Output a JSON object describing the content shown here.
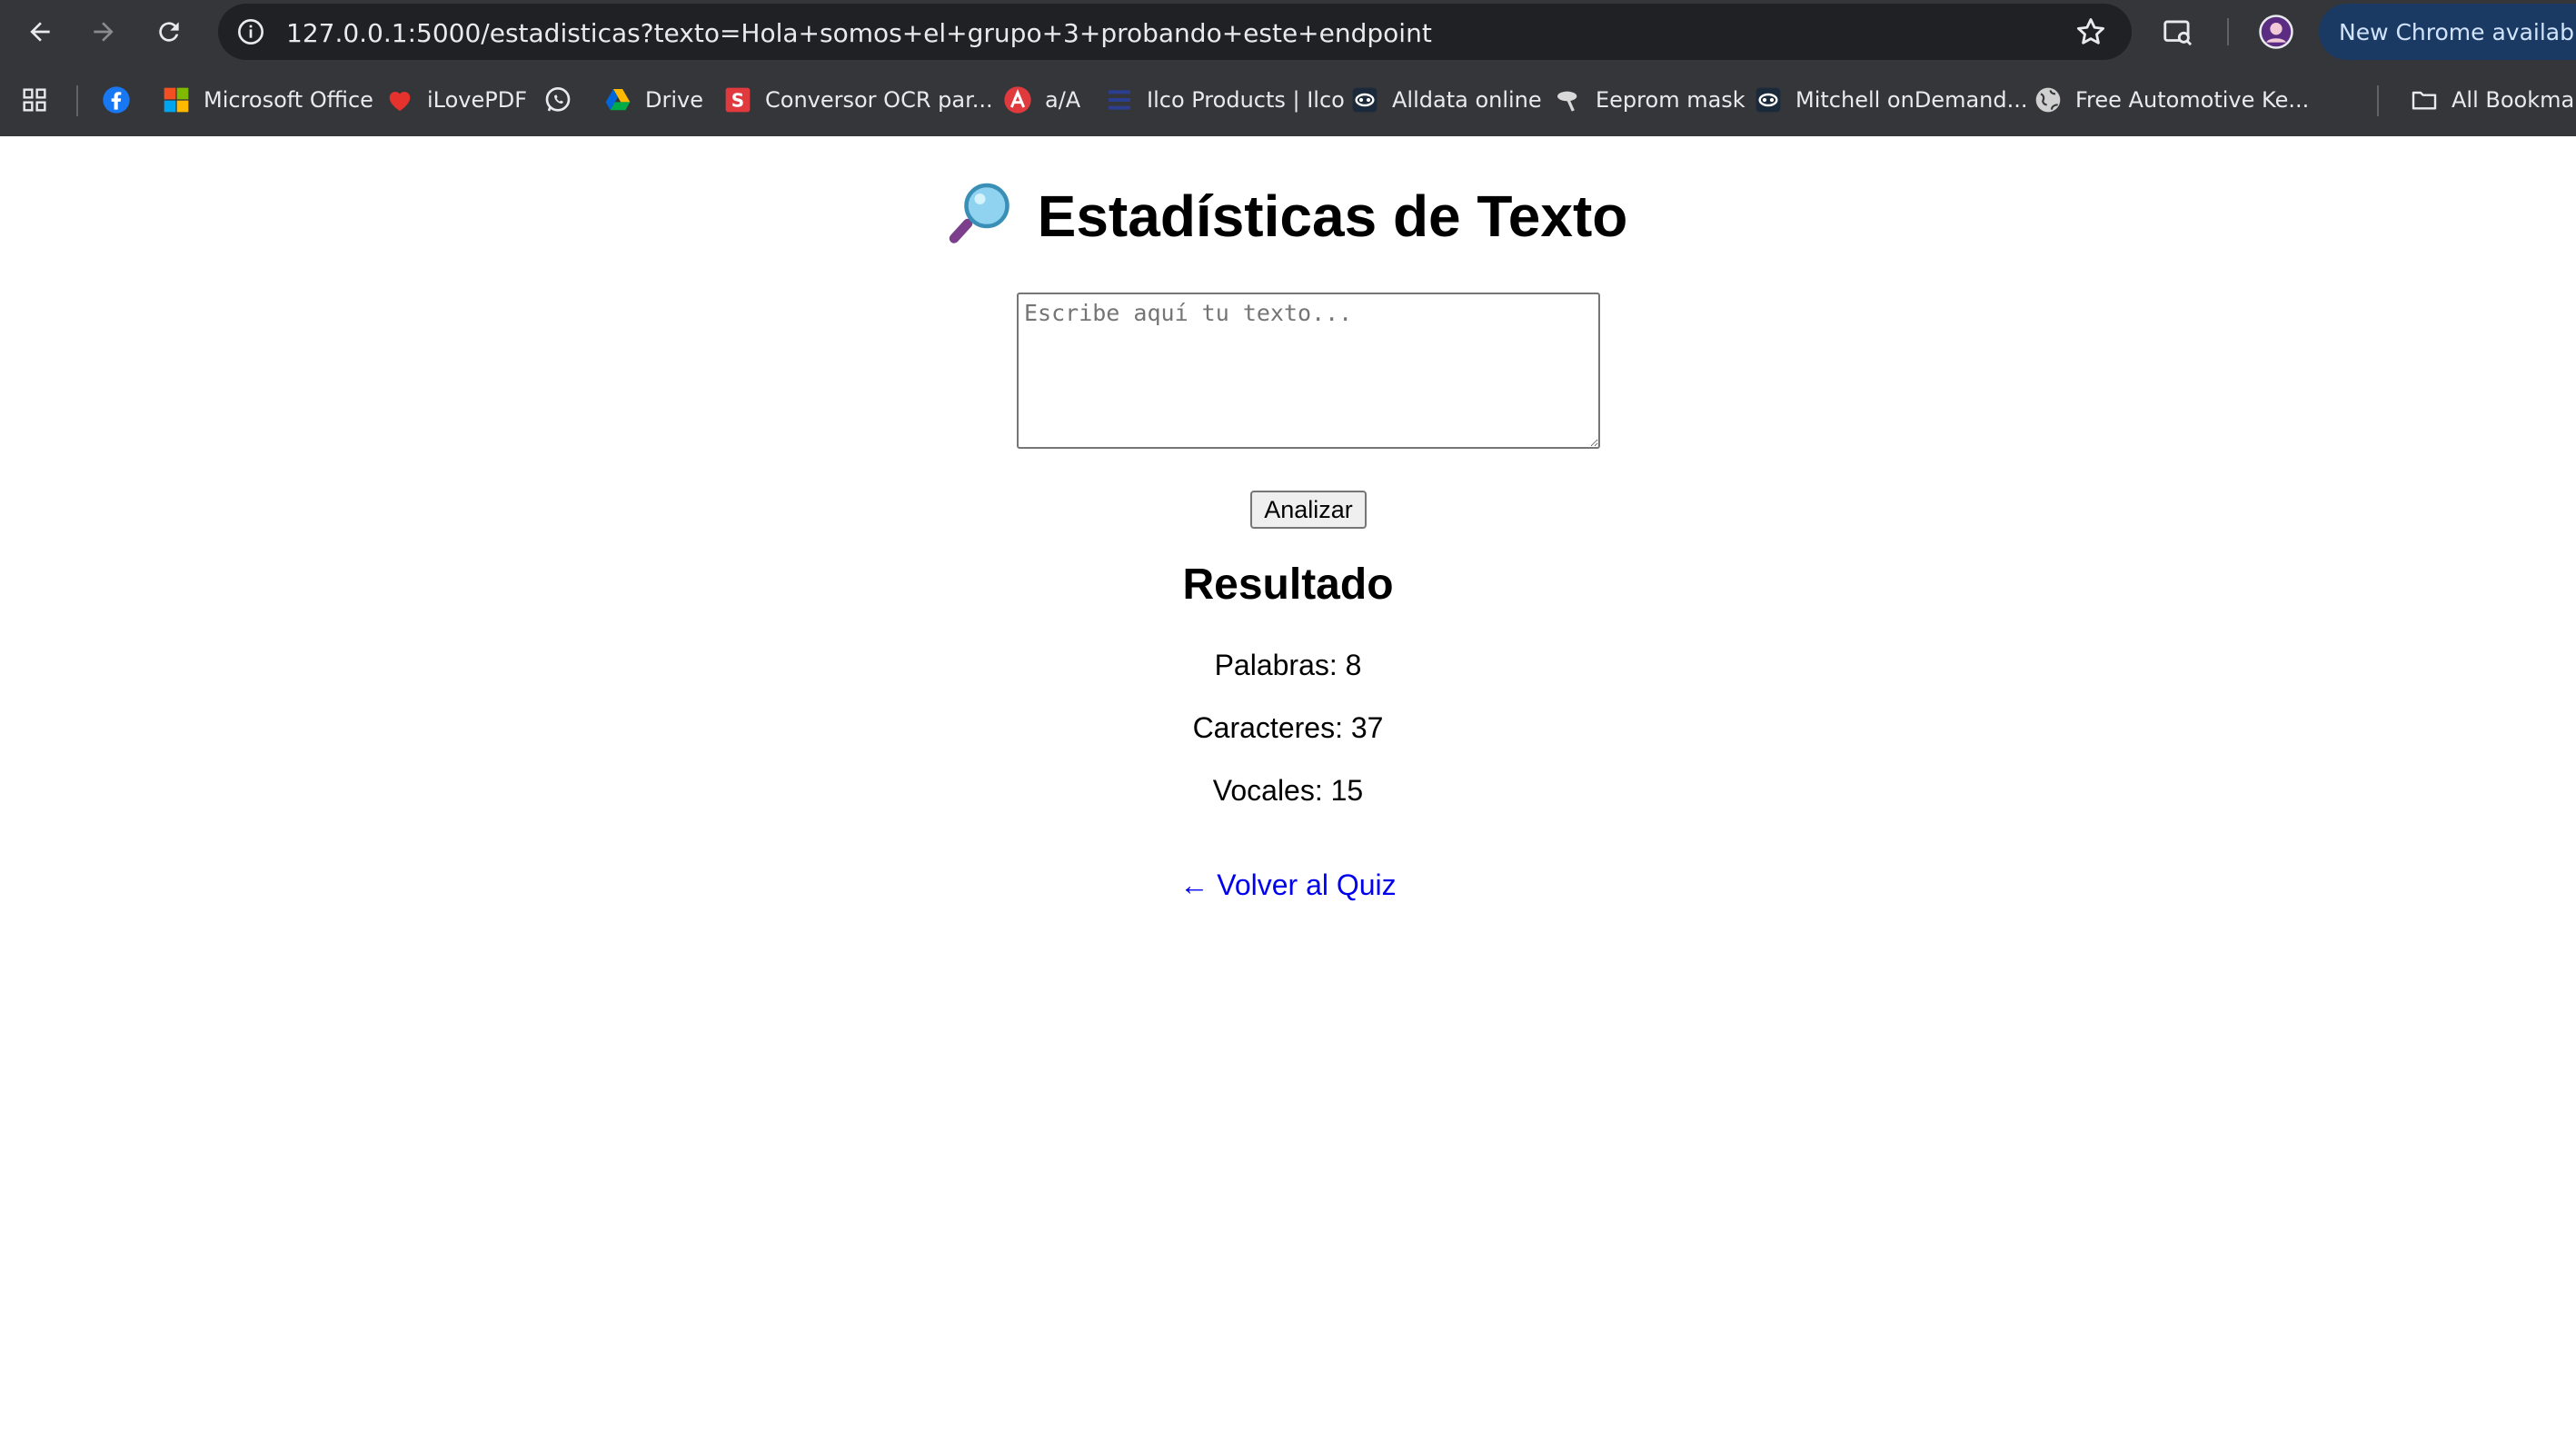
{
  "browser": {
    "url": "127.0.0.1:5000/estadisticas?texto=Hola+somos+el+grupo+3+probando+este+endpoint",
    "update_label": "New Chrome available",
    "bookmarks": [
      {
        "label": "",
        "icon": "facebook-icon"
      },
      {
        "label": "Microsoft Office",
        "icon": "microsoft-office-icon"
      },
      {
        "label": "iLovePDF",
        "icon": "ilovepdf-icon"
      },
      {
        "label": "",
        "icon": "whatsapp-icon"
      },
      {
        "label": "Drive",
        "icon": "google-drive-icon"
      },
      {
        "label": "Conversor OCR par...",
        "icon": "ocr-converter-icon"
      },
      {
        "label": "a/A",
        "icon": "letter-a-icon"
      },
      {
        "label": "Ilco Products | Ilco",
        "icon": "ilco-icon"
      },
      {
        "label": "Alldata online",
        "icon": "alldata-icon"
      },
      {
        "label": "Eeprom mask",
        "icon": "eeprom-icon"
      },
      {
        "label": "Mitchell onDemand...",
        "icon": "mitchell-icon"
      },
      {
        "label": "Free Automotive Ke...",
        "icon": "globe-icon"
      }
    ],
    "all_bookmarks_label": "All Bookmarks"
  },
  "page": {
    "title": "Estadísticas de Texto",
    "title_icon": "magnifying-glass-icon",
    "textarea_placeholder": "Escribe aquí tu texto...",
    "textarea_value": "",
    "analyze_button": "Analizar",
    "result_heading": "Resultado",
    "stats": {
      "words": "Palabras: 8",
      "characters": "Caracteres: 37",
      "vowels": "Vocales: 15"
    },
    "back_link": "← Volver al Quiz"
  }
}
